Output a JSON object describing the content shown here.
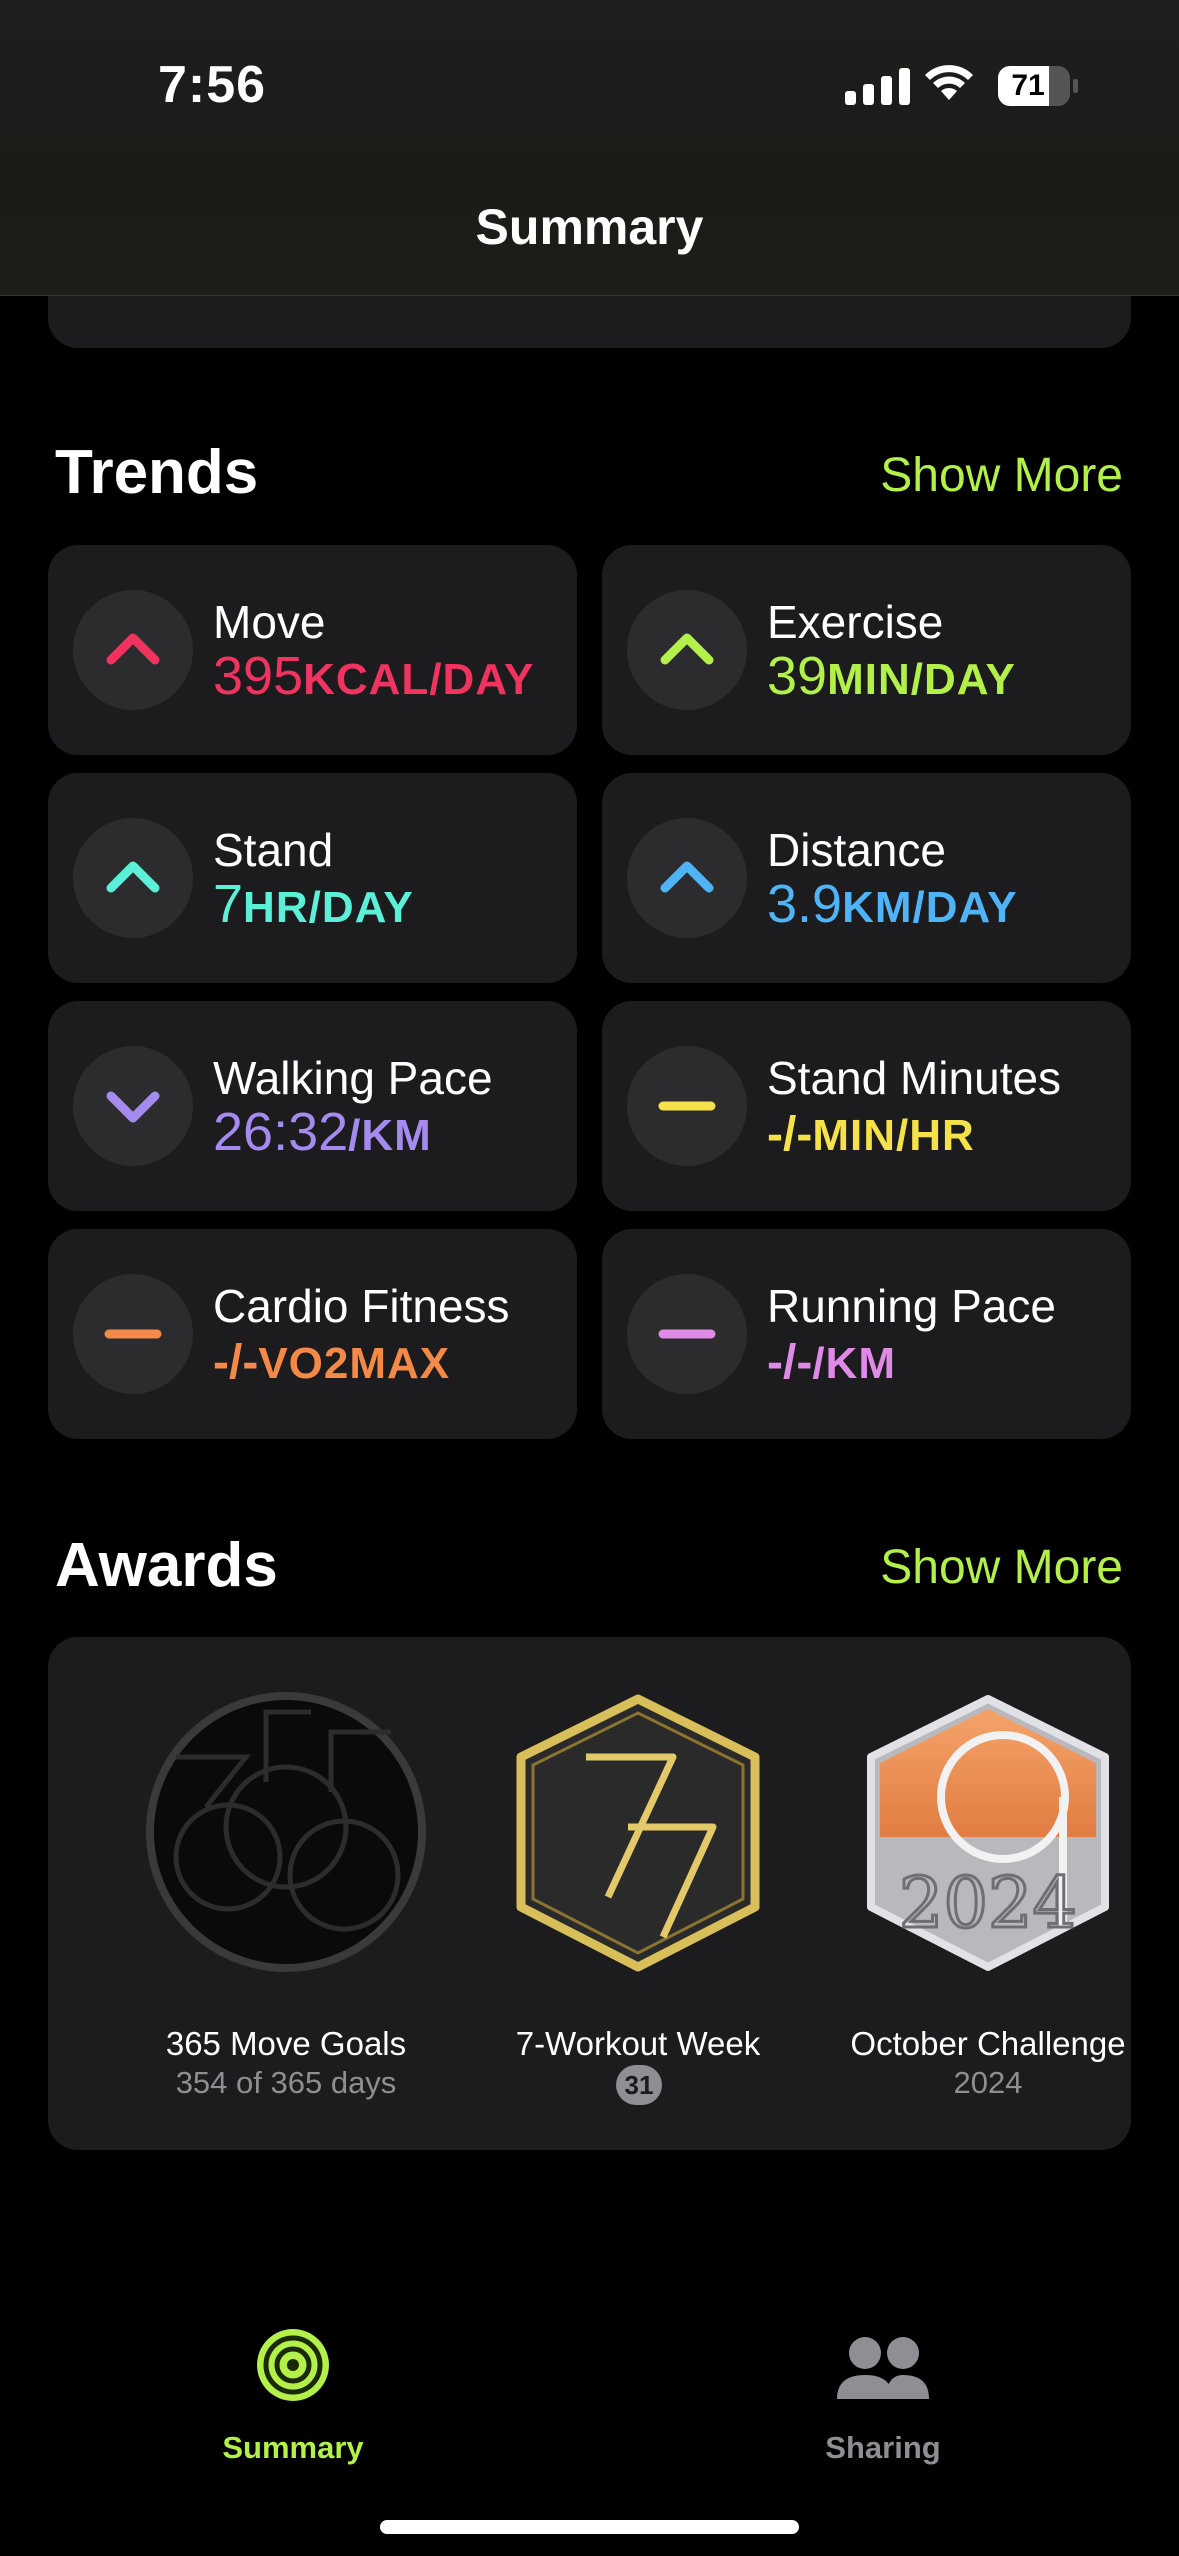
{
  "status_bar": {
    "time": "7:56",
    "battery": "71",
    "battery_level": 0.71
  },
  "nav": {
    "title": "Summary"
  },
  "trends": {
    "title": "Trends",
    "show_more": "Show More",
    "items": [
      {
        "label": "Move",
        "value": "395",
        "unit": "KCAL/DAY",
        "color": "#f0335f",
        "icon": "chevron-up-icon"
      },
      {
        "label": "Exercise",
        "value": "39",
        "unit": "MIN/DAY",
        "color": "#b3f04a",
        "icon": "chevron-up-icon"
      },
      {
        "label": "Stand",
        "value": "7",
        "unit": "HR/DAY",
        "color": "#5cf0d8",
        "icon": "chevron-up-icon"
      },
      {
        "label": "Distance",
        "value": "3.9",
        "unit": "KM/DAY",
        "color": "#4fb3f7",
        "icon": "chevron-up-icon"
      },
      {
        "label": "Walking Pace",
        "value": "26:32",
        "unit": "/KM",
        "color": "#a58af0",
        "icon": "chevron-down-icon"
      },
      {
        "label": "Stand Minutes",
        "value": "-/-",
        "unit": "MIN/HR",
        "color": "#f5e24a",
        "icon": "dash-icon"
      },
      {
        "label": "Cardio Fitness",
        "value": "-/-",
        "unit": "VO2MAX",
        "color": "#f58a48",
        "icon": "dash-icon"
      },
      {
        "label": "Running Pace",
        "value": "-/-",
        "unit": "/KM",
        "color": "#e08ae8",
        "icon": "dash-icon"
      }
    ]
  },
  "awards": {
    "title": "Awards",
    "show_more": "Show More",
    "items": [
      {
        "name": "365 Move Goals",
        "sub": "354 of 365 days",
        "icon": "365-move-goals-award-icon"
      },
      {
        "name": "7-Workout Week",
        "count": "31",
        "icon": "7-workout-week-award-icon"
      },
      {
        "name": "October Challenge",
        "sub": "2024",
        "icon": "october-challenge-2024-award-icon"
      }
    ]
  },
  "tabs": [
    {
      "label": "Summary",
      "active": true,
      "color": "#b3f04a",
      "icon": "activity-rings-icon"
    },
    {
      "label": "Sharing",
      "active": false,
      "color": "#8e8e93",
      "icon": "people-icon"
    }
  ]
}
